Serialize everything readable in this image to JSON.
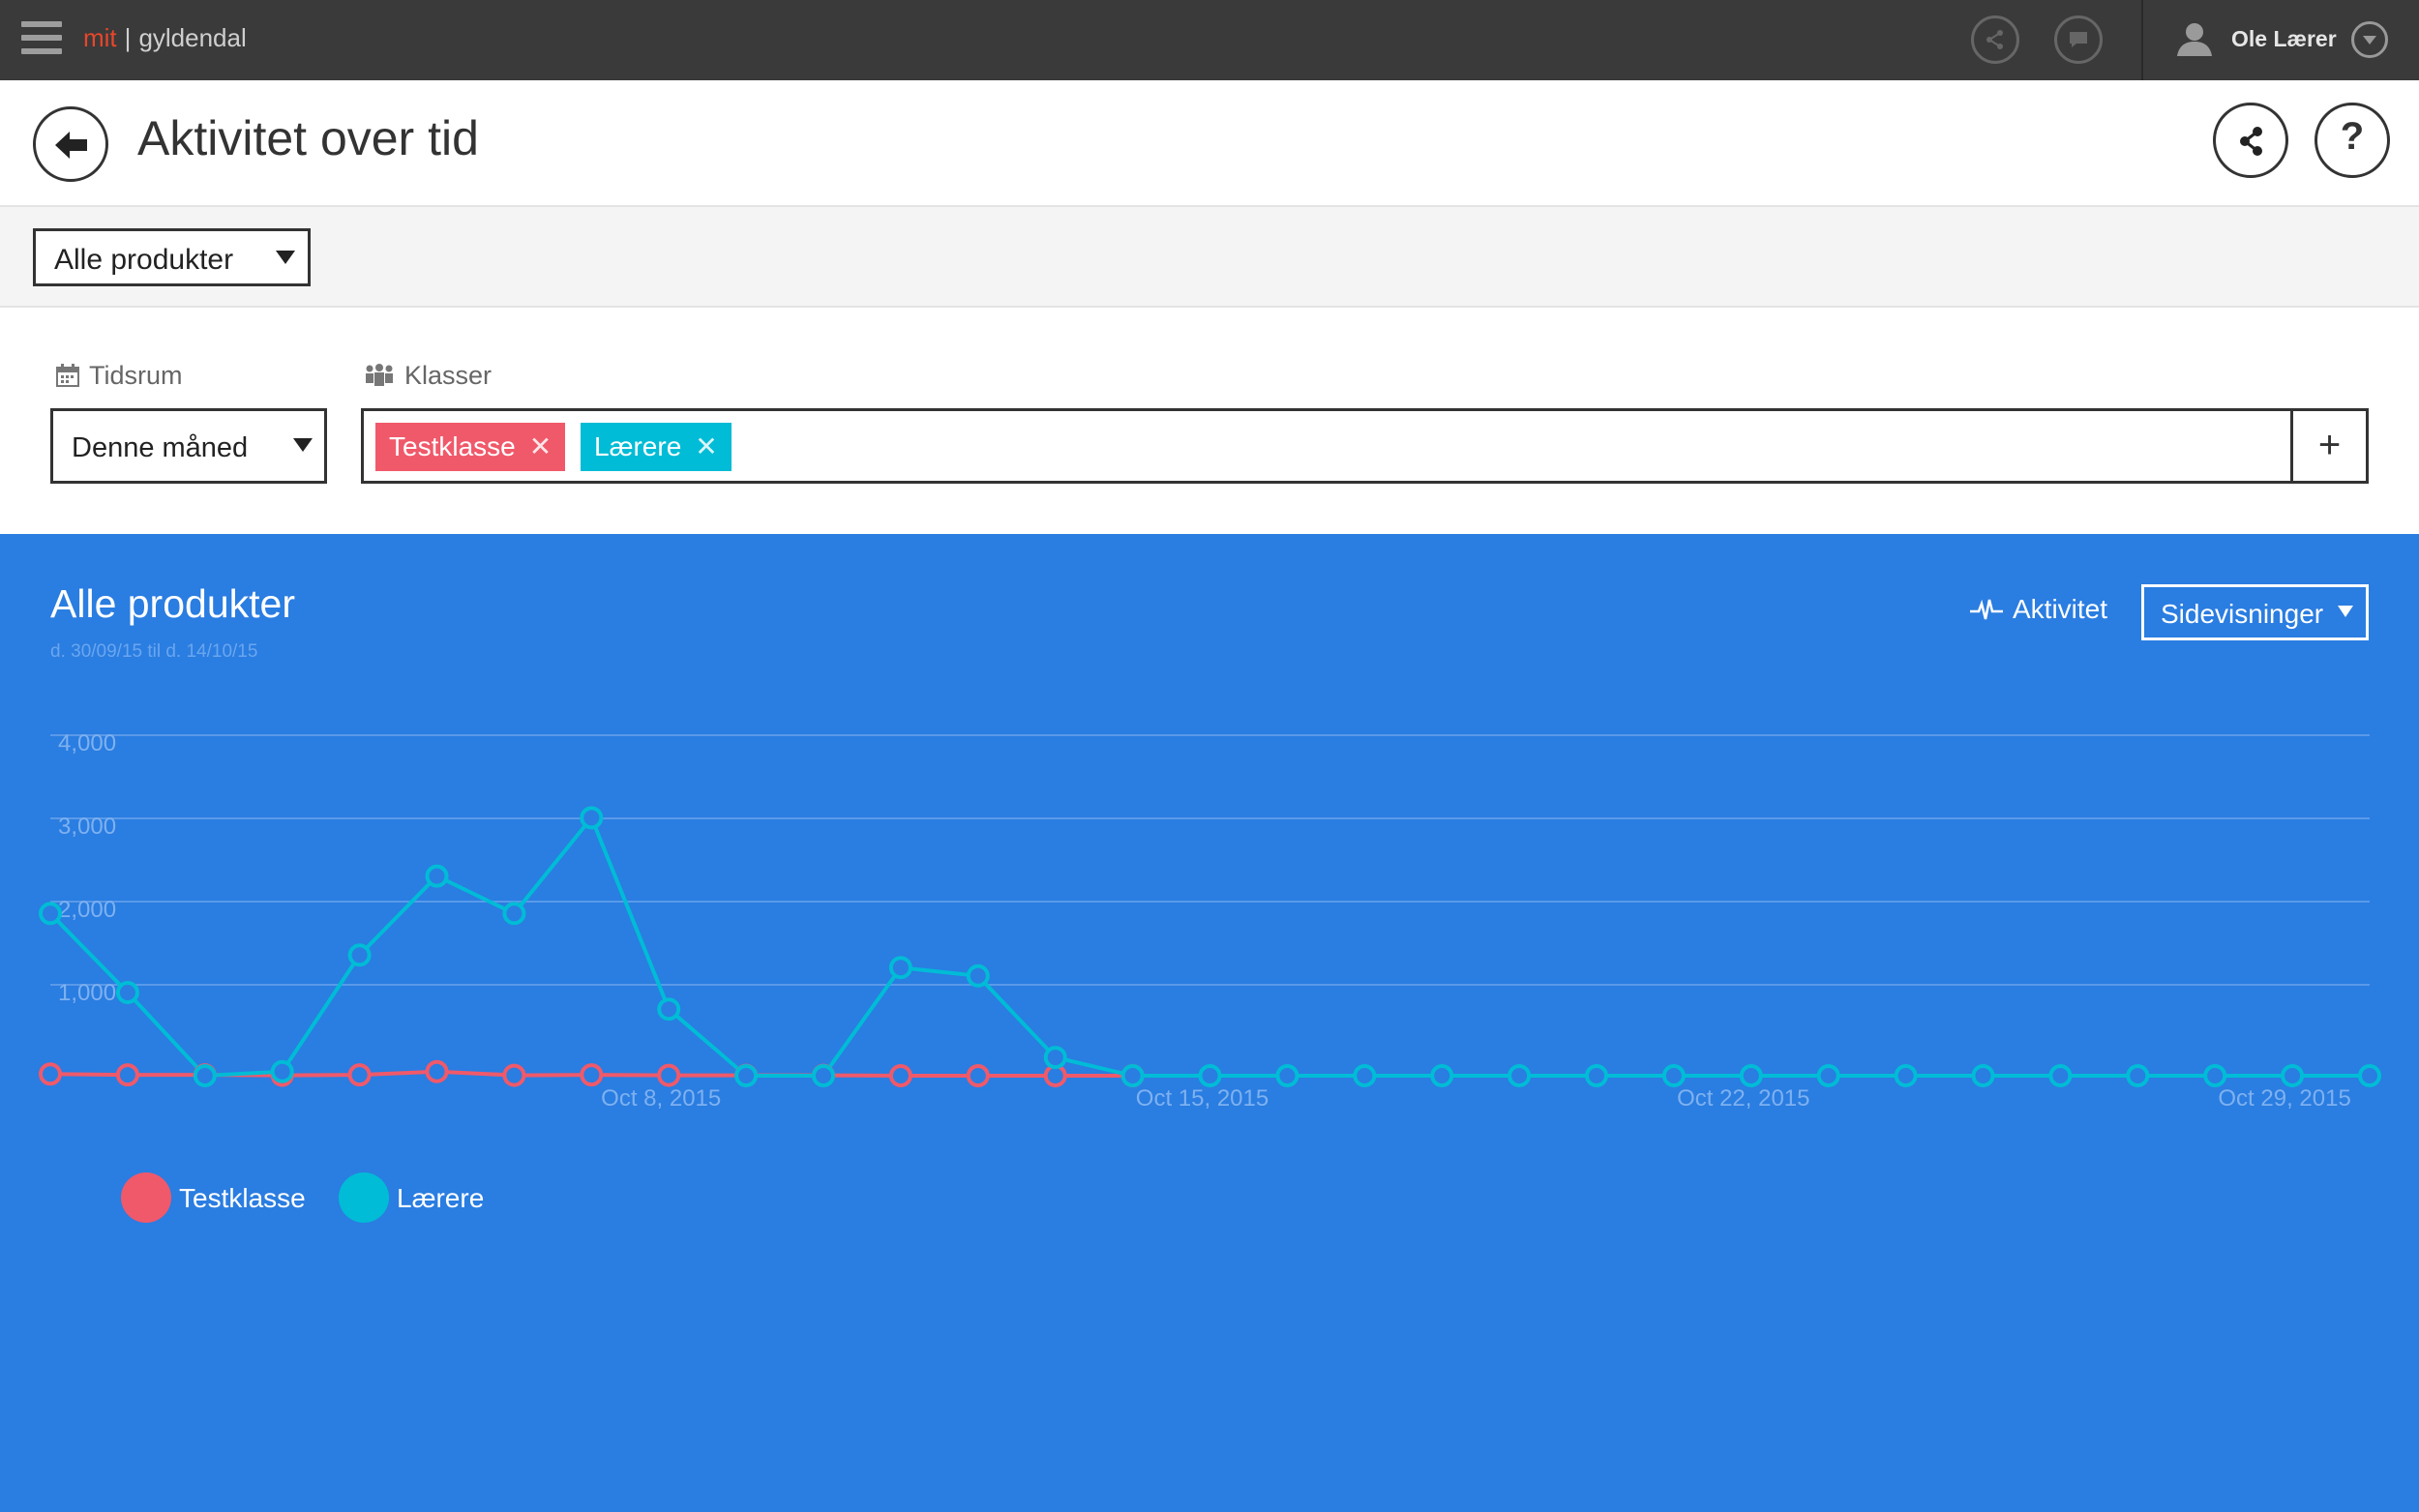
{
  "topbar": {
    "brand_mit": "mit",
    "brand_sep": "|",
    "brand_name": "gyldendal",
    "user_name": "Ole Lærer",
    "icons": [
      "menu-icon",
      "share-icon",
      "chat-icon",
      "user-icon",
      "chevron-down-icon"
    ]
  },
  "header": {
    "title": "Aktivitet over tid",
    "help_label": "?"
  },
  "product_filter": {
    "selected": "Alle produkter"
  },
  "filters": {
    "period_label": "Tidsrum",
    "period_value": "Denne måned",
    "classes_label": "Klasser",
    "tags": [
      {
        "label": "Testklasse",
        "remove": "✕",
        "color": "#f0596a"
      },
      {
        "label": "Lærere",
        "remove": "✕",
        "color": "#00bcd6"
      }
    ],
    "add_label": "+"
  },
  "panel": {
    "title": "Alle produkter",
    "subtitle": "d. 30/09/15 til d. 14/10/15",
    "activity_label": "Aktivitet",
    "metric_selected": "Sidevisninger",
    "background": "#2a7de1"
  },
  "chart_data": {
    "type": "line",
    "x_start": "Sep 30, 2015",
    "x_tick_labels": [
      "Oct 8, 2015",
      "Oct 15, 2015",
      "Oct 22, 2015",
      "Oct 29, 2015"
    ],
    "y_tick_labels": [
      "1,000",
      "2,000",
      "3,000",
      "4,000"
    ],
    "ylim": [
      0,
      4000
    ],
    "x_points": 31,
    "series": [
      {
        "name": "Testklasse",
        "color": "#f0596a",
        "values": [
          20,
          10,
          10,
          5,
          10,
          50,
          5,
          10,
          5,
          5,
          5,
          0,
          0,
          0,
          0
        ]
      },
      {
        "name": "Lærere",
        "color": "#00bcd6",
        "values": [
          1950,
          1000,
          0,
          50,
          1450,
          2400,
          1950,
          3100,
          800,
          0,
          0,
          1300,
          1200,
          220,
          0,
          0,
          0,
          0,
          0,
          0,
          0,
          0,
          0,
          0,
          0,
          0,
          0,
          0,
          0,
          0,
          0
        ]
      }
    ],
    "grid": true,
    "legend_position": "bottom-left"
  }
}
